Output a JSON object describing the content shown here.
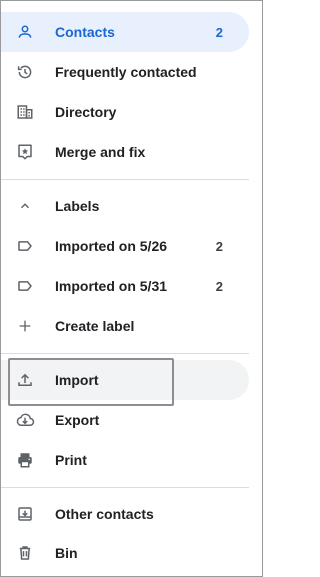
{
  "nav": {
    "contacts": {
      "label": "Contacts",
      "count": "2",
      "icon": "person-icon"
    },
    "frequent": {
      "label": "Frequently contacted",
      "icon": "history-icon"
    },
    "directory": {
      "label": "Directory",
      "icon": "building-icon"
    },
    "merge": {
      "label": "Merge and fix",
      "icon": "merge-fix-icon"
    }
  },
  "labels": {
    "header": "Labels",
    "items": [
      {
        "label": "Imported on 5/26",
        "count": "2",
        "icon": "label-icon"
      },
      {
        "label": "Imported on 5/31",
        "count": "2",
        "icon": "label-icon"
      }
    ],
    "create": "Create label"
  },
  "actions": {
    "import": "Import",
    "export": "Export",
    "print": "Print"
  },
  "other": {
    "other_contacts": "Other contacts",
    "bin": "Bin"
  },
  "colors": {
    "accent": "#1967d2",
    "selected_bg": "#e8f0fe",
    "icon": "#5f6368",
    "text": "#202124"
  }
}
